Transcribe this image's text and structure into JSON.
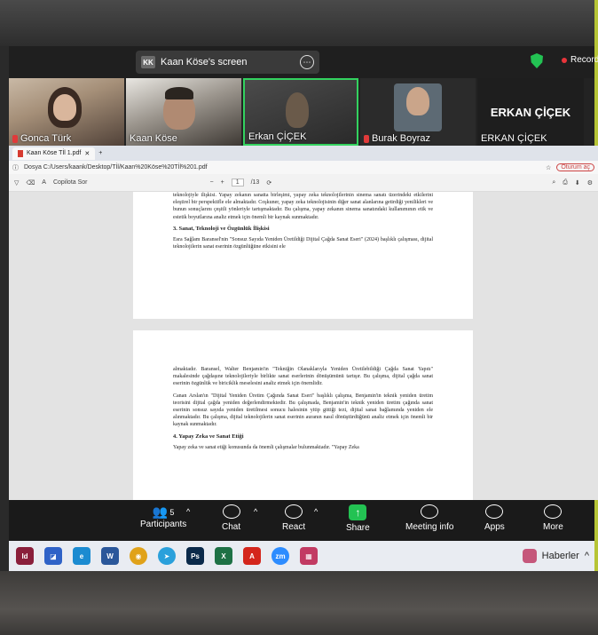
{
  "share_banner": {
    "initials": "KK",
    "label": "Kaan Köse's screen"
  },
  "recording": {
    "label": "Recordir"
  },
  "participants": [
    {
      "name": "Gonca Türk",
      "muted": true
    },
    {
      "name": "Kaan Köse",
      "muted": false
    },
    {
      "name": "Erkan ÇİÇEK",
      "muted": false,
      "active_speaker": true
    },
    {
      "name": "Burak Boyraz",
      "muted": true
    },
    {
      "name": "ERKAN ÇİÇEK",
      "muted": false,
      "display_name": "ERKAN ÇİÇEK"
    }
  ],
  "browser": {
    "tab_title": "Kaan Köse Tİl 1.pdf",
    "url": "Dosya  C:/Users/kaank/Desktop/Tİl/Kaan%20Köse%20Tİl%201.pdf",
    "page_counter": "1",
    "page_total": "/13",
    "toolbar_text": "Copilota Sor",
    "right_label": "Oturum aç"
  },
  "pdf": {
    "page1_lines": [
      "teknolojiyle ilişkisi. Yapay zekanın sanatta birleşimi, yapay zeka teknolojilerinin",
      "sinema sanatı üzerindeki etkilerini eleştirel bir perspektifle ele almaktadır. Coşkuner, yapay",
      "zeka teknolojisinin diğer sanat alanlarına getirdiği yenilikleri ve bunun sonuçlarını çeşitli",
      "yönleriyle tartışmaktadır. Bu çalışma, yapay zekanın sinema sanatındaki kullanımının etik ve",
      "estetik boyutlarına analiz etmek için önemli bir kaynak sunmaktadır."
    ],
    "section3_heading": "3. Sanat, Teknoloji ve Özgünlük İlişkisi",
    "section3_text": "Esra Sağlam Baransel'nin \"Sonsuz Sayıda Yeniden Üretildiği Dijital Çağda Sanat Eseri\" (2024) başlıklı çalışması, dijital teknolojilerin sanat eserinin özgünlüğüne etkisini ele",
    "page2_p1": "almaktadır. Baransel, Walter Benjamin'in \"Tekniğin Olanaklarıyla Yeniden Üretilebildiği Çağda Sanat Yapıtı\" makalesinde çağdaşıne teknolojileriyle birlikte sanat eserlerinin dönüşümünü tartışır. Bu çalışma, dijital çağda sanat eserinin özgünlük ve biriciklik meselesini analiz etmek için önemlidir.",
    "page2_p2": "Canan Arslan'ın \"Dijital Yeniden Üretim Çağında Sanat Eseri\" başlıklı çalışma, Benjamin'in teknik yeniden üretim teorisini dijital çağda yeniden değerlendirmektedir. Bu çalışmada, Benjamin'in teknik yeniden üretim çağında sanat eserinin sonsuz sayıda yeniden üretilmesi sonucu halesinin yitip gittiği tezi, dijital sanat bağlamında yeniden ele alınmaktadır. Bu çalışma, dijital teknolojilerin sanat eserinin auranın nasıl dönüştürdüğünü analiz etmek için önemli bir kaynak sunmaktadır.",
    "section4_heading": "4. Yapay Zeka ve Sanat Etiği",
    "section4_text": "Yapay zeka ve sanat etiği konusunda da önemli çalışmalar bulunmaktadır. \"Yapay Zeka"
  },
  "dock": {
    "participants_label": "Participants",
    "participants_count": "5",
    "chat_label": "Chat",
    "react_label": "React",
    "share_label": "Share",
    "meeting_info_label": "Meeting info",
    "apps_label": "Apps",
    "more_label": "More"
  },
  "taskbar": {
    "apps": [
      {
        "name": "InDesign",
        "glyph": "Id",
        "color": "#8a1f3b"
      },
      {
        "name": "Snipping",
        "glyph": "◪",
        "color": "#2f62c7"
      },
      {
        "name": "Edge",
        "glyph": "e",
        "color": "#1b8bd1"
      },
      {
        "name": "Word",
        "glyph": "W",
        "color": "#2b579a"
      },
      {
        "name": "Chrome",
        "glyph": "◉",
        "color": "#e0a21a"
      },
      {
        "name": "Telegram",
        "glyph": "➤",
        "color": "#2aa0db"
      },
      {
        "name": "Photoshop",
        "glyph": "Ps",
        "color": "#0b2a4a"
      },
      {
        "name": "Excel",
        "glyph": "X",
        "color": "#1e7145"
      },
      {
        "name": "Acrobat",
        "glyph": "A",
        "color": "#d4261c"
      },
      {
        "name": "Zoom",
        "glyph": "zm",
        "color": "#2d8cff"
      },
      {
        "name": "Photos",
        "glyph": "▦",
        "color": "#c23b63"
      }
    ],
    "news_label": "Haberler"
  }
}
